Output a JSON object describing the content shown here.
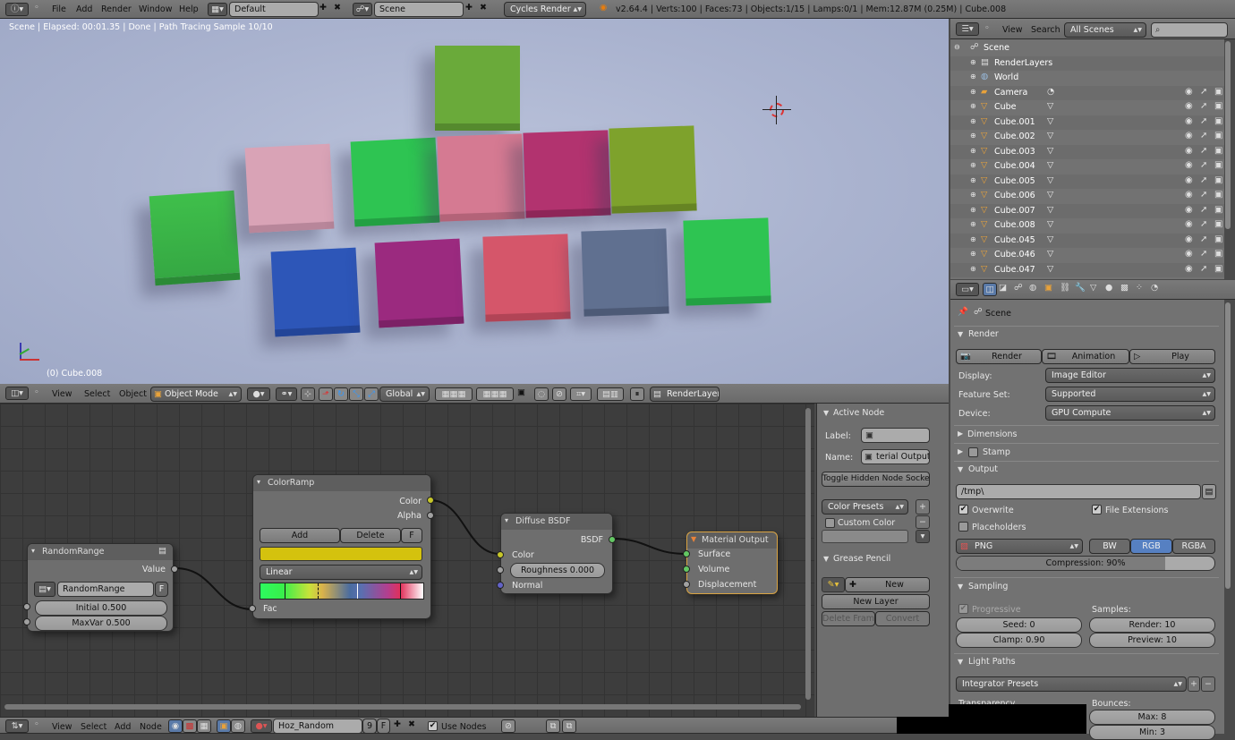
{
  "top_bar": {
    "menus": [
      "File",
      "Add",
      "Render",
      "Window",
      "Help"
    ],
    "screen_layout": "Default",
    "scene": "Scene",
    "engine": "Cycles Render",
    "stats": "v2.64.4 | Verts:100 | Faces:73 | Objects:1/15 | Lamps:0/1 | Mem:12.87M (0.25M) | Cube.008"
  },
  "viewport": {
    "status": "Scene | Elapsed: 00:01.35 | Done | Path Tracing Sample 10/10",
    "object_label": "(0) Cube.008",
    "header": {
      "menus": [
        "View",
        "Select",
        "Object"
      ],
      "mode": "Object Mode",
      "orientation": "Global",
      "render_layer": "RenderLayer"
    },
    "cube_colors": [
      "#3fbf4b",
      "#d9a3b6",
      "#2ec452",
      "#6aaa3a",
      "#d57a92",
      "#b2336f",
      "#7ea22c",
      "#2d56b8",
      "#9b2a7f",
      "#d5566a",
      "#607090",
      "#2ec452"
    ]
  },
  "outliner": {
    "view_menu": "View",
    "search_menu": "Search",
    "scenes_filter": "All Scenes",
    "items": [
      {
        "label": "Scene",
        "indent": 0
      },
      {
        "label": "RenderLayers",
        "indent": 1
      },
      {
        "label": "World",
        "indent": 1
      },
      {
        "label": "Camera",
        "indent": 1
      },
      {
        "label": "Cube",
        "indent": 1
      },
      {
        "label": "Cube.001",
        "indent": 1
      },
      {
        "label": "Cube.002",
        "indent": 1
      },
      {
        "label": "Cube.003",
        "indent": 1
      },
      {
        "label": "Cube.004",
        "indent": 1
      },
      {
        "label": "Cube.005",
        "indent": 1
      },
      {
        "label": "Cube.006",
        "indent": 1
      },
      {
        "label": "Cube.007",
        "indent": 1
      },
      {
        "label": "Cube.008",
        "indent": 1
      },
      {
        "label": "Cube.045",
        "indent": 1
      },
      {
        "label": "Cube.046",
        "indent": 1
      },
      {
        "label": "Cube.047",
        "indent": 1
      }
    ]
  },
  "properties": {
    "context": "Scene",
    "render": {
      "title": "Render",
      "render_btn": "Render",
      "animation_btn": "Animation",
      "play_btn": "Play",
      "display_label": "Display:",
      "display_value": "Image Editor",
      "feature_label": "Feature Set:",
      "feature_value": "Supported",
      "device_label": "Device:",
      "device_value": "GPU Compute"
    },
    "dimensions_title": "Dimensions",
    "stamp_title": "Stamp",
    "output": {
      "title": "Output",
      "path": "/tmp\\",
      "overwrite": "Overwrite",
      "file_extensions": "File Extensions",
      "placeholders": "Placeholders",
      "format": "PNG",
      "bw": "BW",
      "rgb": "RGB",
      "rgba": "RGBA",
      "compression": "Compression: 90%",
      "compression_value": 0.9
    },
    "sampling": {
      "title": "Sampling",
      "progressive": "Progressive",
      "samples_label": "Samples:",
      "seed": "Seed: 0",
      "clamp": "Clamp: 0.90",
      "render": "Render: 10",
      "preview": "Preview: 10"
    },
    "light_paths": {
      "title": "Light Paths",
      "presets": "Integrator Presets",
      "transparency": "Transparency",
      "bounces": "Bounces:",
      "max": "Max: 8",
      "min": "Min: 3"
    }
  },
  "node_editor": {
    "side_panel": {
      "active_node_title": "Active Node",
      "label_label": "Label:",
      "name_label": "Name:",
      "name_value": "terial Output",
      "toggle_hidden": "Toggle Hidden Node Sockets",
      "color_presets": "Color Presets",
      "custom_color": "Custom Color",
      "grease_pencil_title": "Grease Pencil",
      "new_btn": "New",
      "new_layer": "New Layer",
      "delete_frame": "Delete Frame",
      "convert": "Convert"
    },
    "nodes": {
      "random_range": {
        "title": "RandomRange",
        "out_value": "Value",
        "script": "RandomRange",
        "script_f": "F",
        "initial": "Initial 0.500",
        "maxvar": "MaxVar 0.500"
      },
      "color_ramp": {
        "title": "ColorRamp",
        "out_color": "Color",
        "out_alpha": "Alpha",
        "add": "Add",
        "delete": "Delete",
        "f": "F",
        "interp": "Linear",
        "in_fac": "Fac",
        "swatch": "#d4c20e"
      },
      "diffuse": {
        "title": "Diffuse BSDF",
        "out_bsdf": "BSDF",
        "in_color": "Color",
        "roughness": "Roughness 0.000",
        "in_normal": "Normal"
      },
      "material_output": {
        "title": "Material Output",
        "surface": "Surface",
        "volume": "Volume",
        "displacement": "Displacement"
      }
    },
    "header": {
      "menus": [
        "View",
        "Select",
        "Add",
        "Node"
      ],
      "material": "Hoz_Random",
      "users": "9",
      "f": "F",
      "use_nodes": "Use Nodes"
    }
  }
}
